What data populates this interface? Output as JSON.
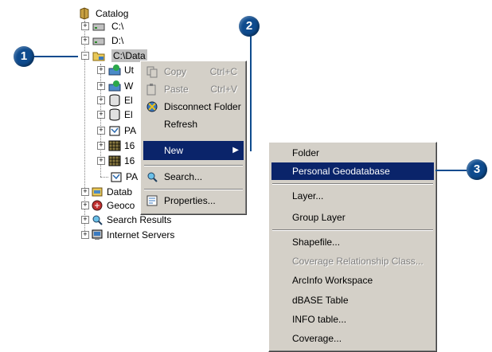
{
  "tree": {
    "root": "Catalog",
    "items": [
      {
        "label": "C:\\"
      },
      {
        "label": "D:\\"
      },
      {
        "label": "C:\\Data"
      },
      {
        "label": "Ut"
      },
      {
        "label": "W"
      },
      {
        "label": "El"
      },
      {
        "label": "El"
      },
      {
        "label": "PA"
      },
      {
        "label": "16"
      },
      {
        "label": "16"
      },
      {
        "label": "PA"
      },
      {
        "label": "Datab"
      },
      {
        "label": "Geoco"
      },
      {
        "label": "Search Results"
      },
      {
        "label": "Internet Servers"
      }
    ]
  },
  "context_menu": {
    "copy": {
      "label": "Copy",
      "shortcut": "Ctrl+C",
      "enabled": false
    },
    "paste": {
      "label": "Paste",
      "shortcut": "Ctrl+V",
      "enabled": false
    },
    "disconnect": {
      "label": "Disconnect Folder"
    },
    "refresh": {
      "label": "Refresh"
    },
    "new": {
      "label": "New"
    },
    "search": {
      "label": "Search..."
    },
    "properties": {
      "label": "Properties..."
    }
  },
  "new_submenu": {
    "folder": "Folder",
    "personal_gdb": "Personal Geodatabase",
    "layer": "Layer...",
    "group_layer": "Group Layer",
    "shapefile": "Shapefile...",
    "coverage_rel": "Coverage Relationship Class...",
    "arcinfo_ws": "ArcInfo Workspace",
    "dbase": "dBASE Table",
    "info": "INFO table...",
    "coverage": "Coverage..."
  },
  "callouts": {
    "one": "1",
    "two": "2",
    "three": "3"
  },
  "colors": {
    "highlight": "#0a246a",
    "callout": "#0e4b8e",
    "menu_bg": "#d4d0c8"
  }
}
